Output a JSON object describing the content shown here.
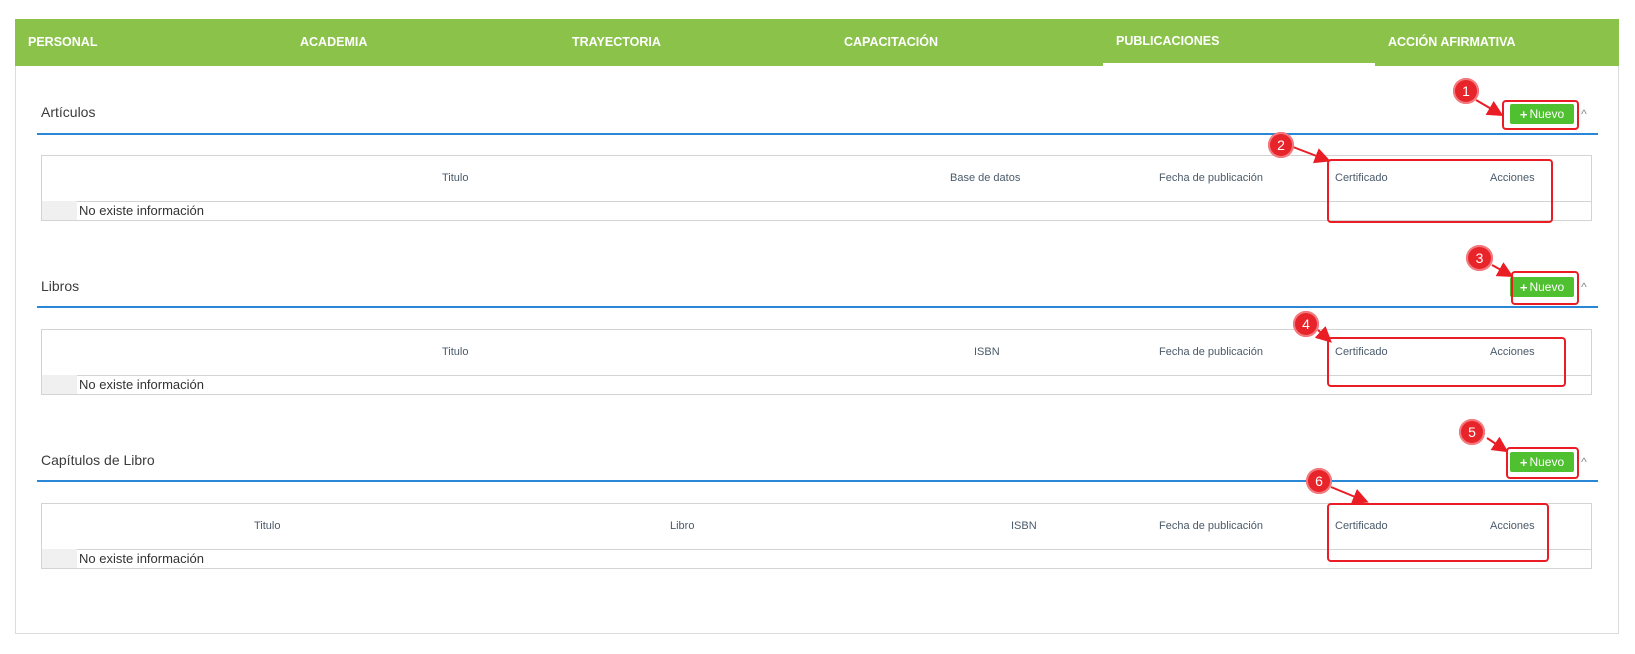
{
  "tabs": [
    {
      "label": "PERSONAL"
    },
    {
      "label": "ACADEMIA"
    },
    {
      "label": "TRAYECTORIA"
    },
    {
      "label": "CAPACITACIÓN"
    },
    {
      "label": "PUBLICACIONES",
      "active": true
    },
    {
      "label": "ACCIÓN AFIRMATIVA"
    }
  ],
  "sections": [
    {
      "title": "Artículos",
      "new_button": "Nuevo",
      "columns": [
        "Titulo",
        "Base de datos",
        "Fecha de publicación",
        "Certificado",
        "Acciones"
      ],
      "empty_text": "No existe información"
    },
    {
      "title": "Libros",
      "new_button": "Nuevo",
      "columns": [
        "Titulo",
        "ISBN",
        "Fecha de publicación",
        "Certificado",
        "Acciones"
      ],
      "empty_text": "No existe información"
    },
    {
      "title": "Capítulos de Libro",
      "new_button": "Nuevo",
      "columns": [
        "Titulo",
        "Libro",
        "ISBN",
        "Fecha de publicación",
        "Certificado",
        "Acciones"
      ],
      "empty_text": "No existe información"
    }
  ],
  "annotations": [
    "1",
    "2",
    "3",
    "4",
    "5",
    "6"
  ],
  "colors": {
    "tabbar": "#8bc34a",
    "new_button": "#4fc02f",
    "section_rule": "#2a86d6",
    "annotation": "#e8242b"
  },
  "icons": [
    "plus-icon",
    "chevron-up-icon"
  ]
}
